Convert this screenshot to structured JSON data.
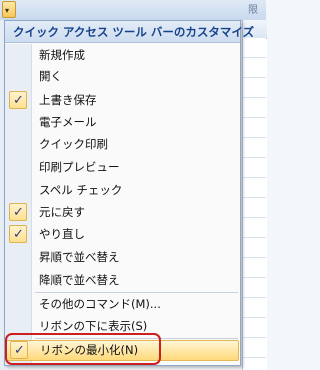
{
  "background": {
    "qat_dropdown_glyph": "▾",
    "partial_cell_text": "限"
  },
  "menu": {
    "title": "クイック アクセス ツール バーのカスタマイズ",
    "items": [
      {
        "label": "新規作成",
        "checked": false
      },
      {
        "label": "開く",
        "checked": false
      },
      {
        "label": "上書き保存",
        "checked": true
      },
      {
        "label": "電子メール",
        "checked": false
      },
      {
        "label": "クイック印刷",
        "checked": false
      },
      {
        "label": "印刷プレビュー",
        "checked": false
      },
      {
        "label": "スペル チェック",
        "checked": false
      },
      {
        "label": "元に戻す",
        "checked": true
      },
      {
        "label": "やり直し",
        "checked": true
      },
      {
        "label": "昇順で並べ替え",
        "checked": false
      },
      {
        "label": "降順で並べ替え",
        "checked": false
      },
      {
        "label": "その他のコマンド(M)...",
        "checked": false
      },
      {
        "label": "リボンの下に表示(S)",
        "checked": false
      },
      {
        "label": "リボンの最小化(N)",
        "checked": true,
        "highlighted": true
      }
    ],
    "check_glyph": "✓"
  },
  "colors": {
    "header_text": "#15428b",
    "highlight_outline": "#cc1f1f"
  }
}
